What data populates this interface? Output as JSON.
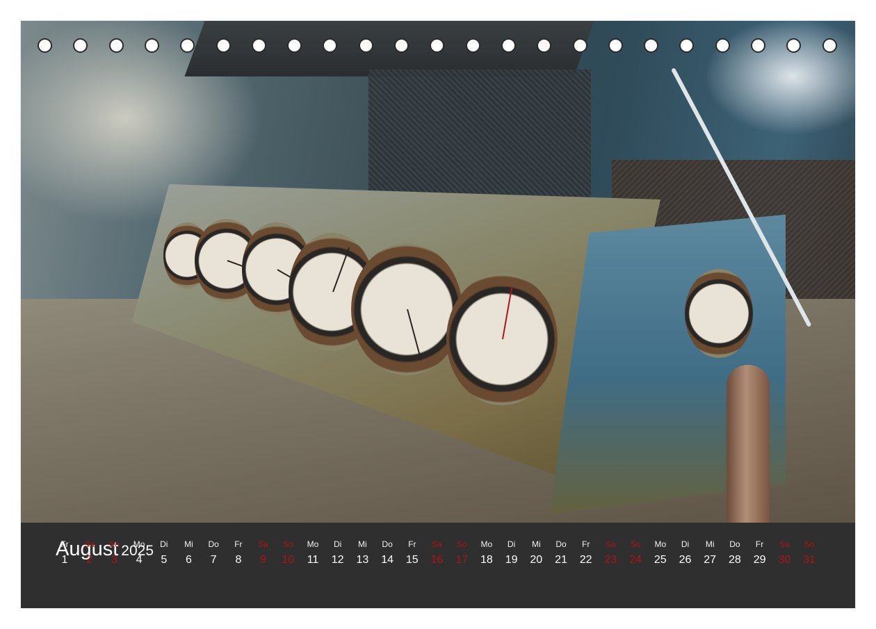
{
  "calendar": {
    "month": "August",
    "year": "2025",
    "weekend_color": "#b0131a",
    "text_color": "#ffffff",
    "strip_color": "#2f2f2f",
    "days": [
      {
        "wd": "Fr",
        "n": "1",
        "weekend": false
      },
      {
        "wd": "Sa",
        "n": "2",
        "weekend": true
      },
      {
        "wd": "So",
        "n": "3",
        "weekend": true
      },
      {
        "wd": "Mo",
        "n": "4",
        "weekend": false
      },
      {
        "wd": "Di",
        "n": "5",
        "weekend": false
      },
      {
        "wd": "Mi",
        "n": "6",
        "weekend": false
      },
      {
        "wd": "Do",
        "n": "7",
        "weekend": false
      },
      {
        "wd": "Fr",
        "n": "8",
        "weekend": false
      },
      {
        "wd": "Sa",
        "n": "9",
        "weekend": true
      },
      {
        "wd": "So",
        "n": "10",
        "weekend": true
      },
      {
        "wd": "Mo",
        "n": "11",
        "weekend": false
      },
      {
        "wd": "Di",
        "n": "12",
        "weekend": false
      },
      {
        "wd": "Mi",
        "n": "13",
        "weekend": false
      },
      {
        "wd": "Do",
        "n": "14",
        "weekend": false
      },
      {
        "wd": "Fr",
        "n": "15",
        "weekend": false
      },
      {
        "wd": "Sa",
        "n": "16",
        "weekend": true
      },
      {
        "wd": "So",
        "n": "17",
        "weekend": true
      },
      {
        "wd": "Mo",
        "n": "18",
        "weekend": false
      },
      {
        "wd": "Di",
        "n": "19",
        "weekend": false
      },
      {
        "wd": "Mi",
        "n": "20",
        "weekend": false
      },
      {
        "wd": "Do",
        "n": "21",
        "weekend": false
      },
      {
        "wd": "Fr",
        "n": "22",
        "weekend": false
      },
      {
        "wd": "Sa",
        "n": "23",
        "weekend": true
      },
      {
        "wd": "So",
        "n": "24",
        "weekend": true
      },
      {
        "wd": "Mo",
        "n": "25",
        "weekend": false
      },
      {
        "wd": "Di",
        "n": "26",
        "weekend": false
      },
      {
        "wd": "Mi",
        "n": "27",
        "weekend": false
      },
      {
        "wd": "Do",
        "n": "28",
        "weekend": false
      },
      {
        "wd": "Fr",
        "n": "29",
        "weekend": false
      },
      {
        "wd": "Sa",
        "n": "30",
        "weekend": true
      },
      {
        "wd": "So",
        "n": "31",
        "weekend": true
      }
    ]
  },
  "photo": {
    "subject_icon": "industrial-gauge-panel-photo"
  }
}
